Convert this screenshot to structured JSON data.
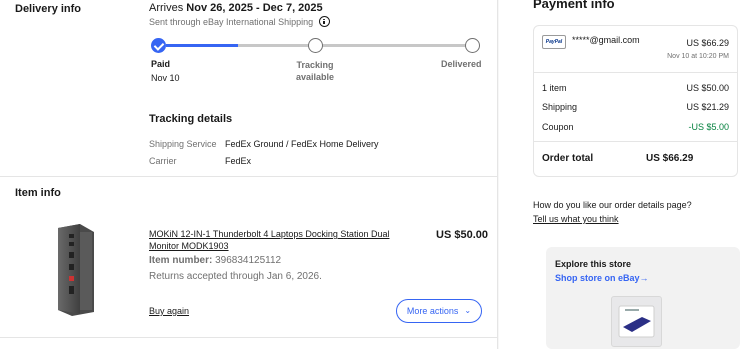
{
  "delivery": {
    "section_label": "Delivery info",
    "arrives_prefix": "Arrives ",
    "arrives_range": "Nov 26, 2025 - Dec 7, 2025",
    "shipped_through": "Sent through eBay International Shipping",
    "steps": [
      {
        "label": "Paid",
        "date": "Nov 10",
        "state": "complete"
      },
      {
        "label": "Tracking available",
        "state": "pending"
      },
      {
        "label": "Delivered",
        "state": "pending"
      }
    ],
    "progress_fraction": 0.23,
    "tracking_title": "Tracking details",
    "shipping_service_label": "Shipping Service",
    "shipping_service_value": "FedEx Ground / FedEx Home Delivery",
    "carrier_label": "Carrier",
    "carrier_value": "FedEx"
  },
  "item": {
    "section_label": "Item info",
    "title": "MOKiN 12-IN-1 Thunderbolt 4 Laptops Docking Station Dual Monitor MODK1903",
    "price": "US $50.00",
    "item_number_label": "Item number:",
    "item_number_value": "396834125112",
    "returns_text": "Returns accepted through Jan 6, 2026.",
    "buy_again": "Buy again",
    "more_actions": "More actions"
  },
  "payment": {
    "title": "Payment info",
    "method_badge": "PayPal",
    "email": "*****@gmail.com",
    "amount": "US $66.29",
    "paid_date": "Nov 10 at 10:20 PM",
    "items_label": "1 item",
    "items_value": "US $50.00",
    "shipping_label": "Shipping",
    "shipping_value": "US $21.29",
    "coupon_label": "Coupon",
    "coupon_value": "-US $5.00",
    "total_label": "Order total",
    "total_value": "US $66.29"
  },
  "feedback": {
    "question": "How do you like our order details page?",
    "link": "Tell us what you think"
  },
  "store": {
    "title": "Explore this store",
    "link": "Shop store on eBay→"
  },
  "colors": {
    "accent": "#3665f3",
    "success": "#05823f",
    "muted": "#707070"
  }
}
